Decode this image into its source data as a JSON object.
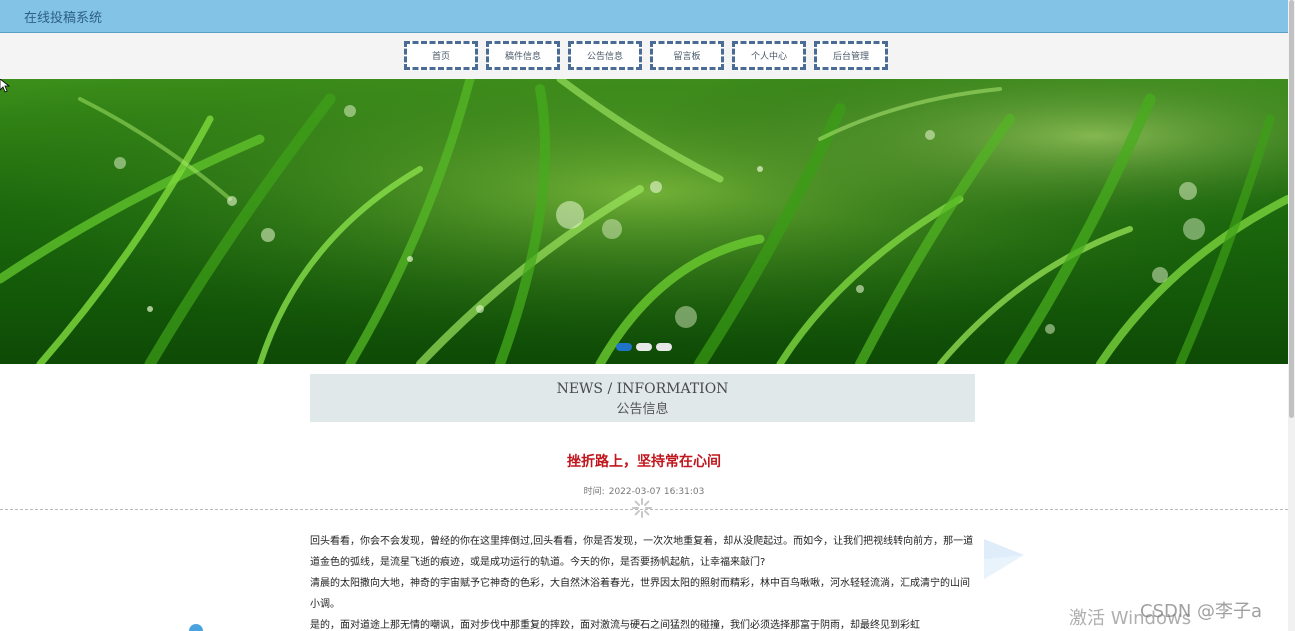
{
  "app": {
    "title": "在线投稿系统"
  },
  "nav": {
    "items": [
      {
        "label": "首页"
      },
      {
        "label": "稿件信息"
      },
      {
        "label": "公告信息"
      },
      {
        "label": "留言板"
      },
      {
        "label": "个人中心"
      },
      {
        "label": "后台管理"
      }
    ]
  },
  "banner": {
    "slide_count": 3,
    "active_slide": 1
  },
  "section": {
    "title_en": "NEWS / INFORMATION",
    "title_zh": "公告信息"
  },
  "article": {
    "title": "挫折路上，坚持常在心间",
    "time_label": "时间:",
    "time_value": "2022-03-07 16:31:03",
    "paragraphs": [
      "回头看看，你会不会发现，曾经的你在这里摔倒过,回头看看，你是否发现，一次次地重复着，却从没爬起过。而如今，让我们把视线转向前方，那一道道金色的弧线，是流星飞逝的痕迹，或是成功运行的轨道。今天的你，是否要扬帆起航，让幸福来敲门?",
      "清晨的太阳撒向大地，神奇的宇宙赋予它神奇的色彩，大自然沐浴着春光，世界因太阳的照射而精彩，林中百鸟啾啾，河水轻轻流淌，汇成清宁的山间小调。",
      "是的，面对道途上那无情的嘲讽，面对步伐中那重复的摔跤，面对激流与硬石之间猛烈的碰撞，我们必须选择那富于阴雨，却最终见到彩虹"
    ]
  },
  "watermarks": {
    "activate": "激活 Windows",
    "csdn": "CSDN @李子a"
  },
  "colors": {
    "titlebar": "#82c3e6",
    "nav_border": "#4a6b94",
    "article_title": "#c0161d",
    "dot_active": "#1f74c9"
  }
}
